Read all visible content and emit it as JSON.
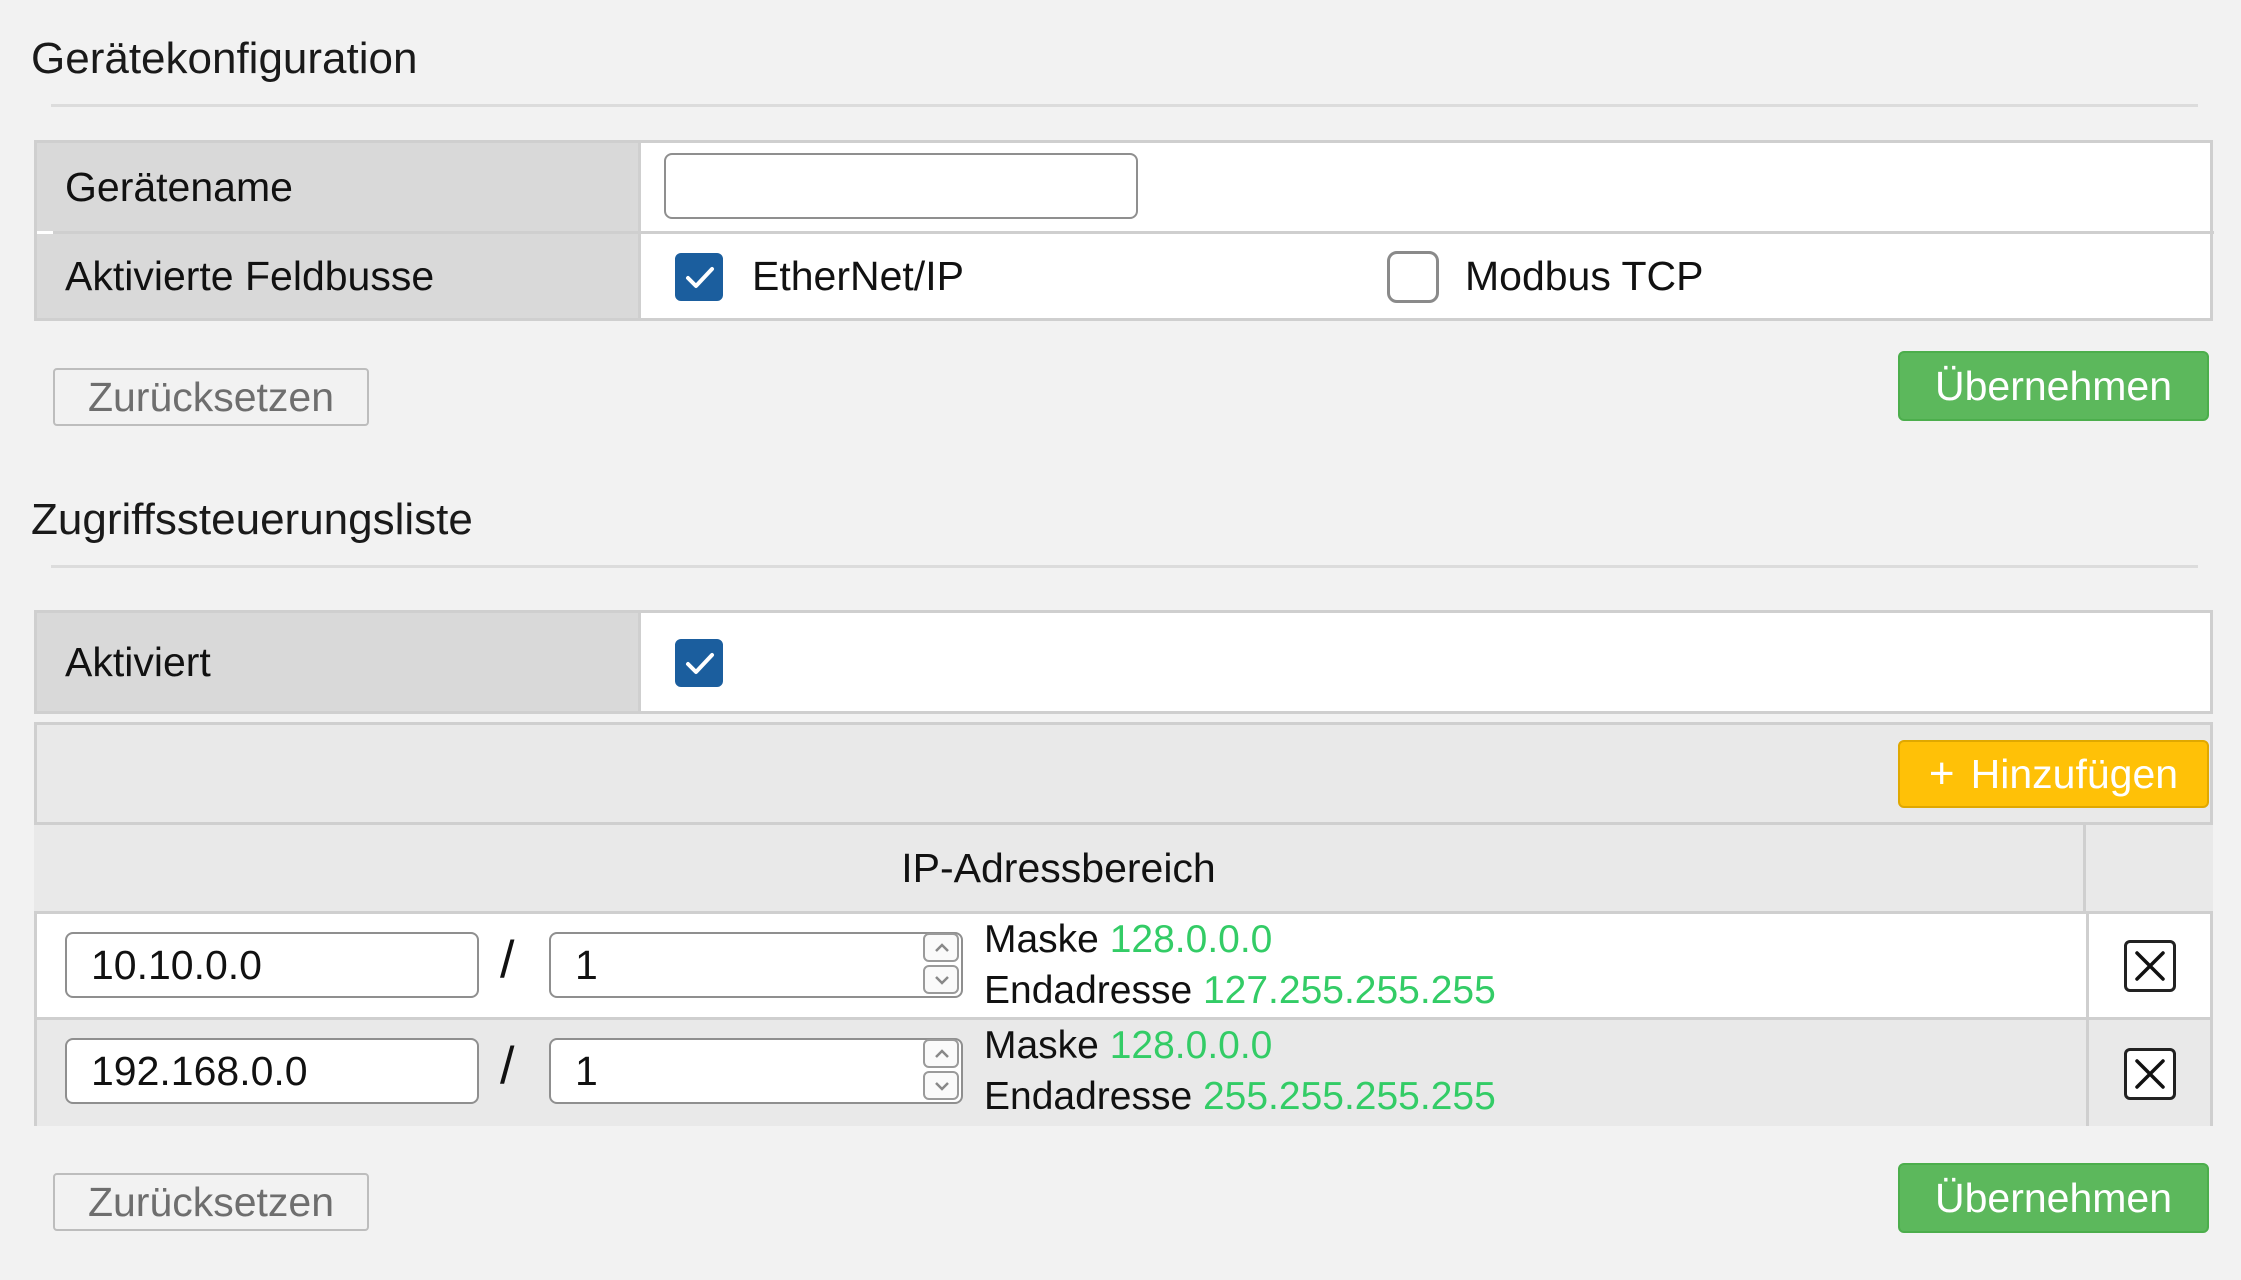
{
  "device_config": {
    "title": "Gerätekonfiguration",
    "device_name_label": "Gerätename",
    "device_name_value": "",
    "fieldbus_label": "Aktivierte Feldbusse",
    "fieldbus_options": [
      {
        "label": "EtherNet/IP",
        "checked": true
      },
      {
        "label": "Modbus TCP",
        "checked": false
      }
    ],
    "reset_label": "Zurücksetzen",
    "apply_label": "Übernehmen"
  },
  "acl": {
    "title": "Zugriffssteuerungsliste",
    "enabled_label": "Aktiviert",
    "enabled": true,
    "add_label": "Hinzufügen",
    "column_header": "IP-Adressbereich",
    "rows": [
      {
        "ip": "10.10.0.0",
        "prefix": "1",
        "mask_label": "Maske",
        "mask": "128.0.0.0",
        "end_label": "Endadresse",
        "end": "127.255.255.255"
      },
      {
        "ip": "192.168.0.0",
        "prefix": "1",
        "mask_label": "Maske",
        "mask": "128.0.0.0",
        "end_label": "Endadresse",
        "end": "255.255.255.255"
      }
    ],
    "reset_label": "Zurücksetzen",
    "apply_label": "Übernehmen"
  },
  "colors": {
    "accent_blue": "#1b5e9e",
    "apply_green": "#5cb85c",
    "add_yellow": "#ffc107",
    "value_green": "#33cc66"
  }
}
